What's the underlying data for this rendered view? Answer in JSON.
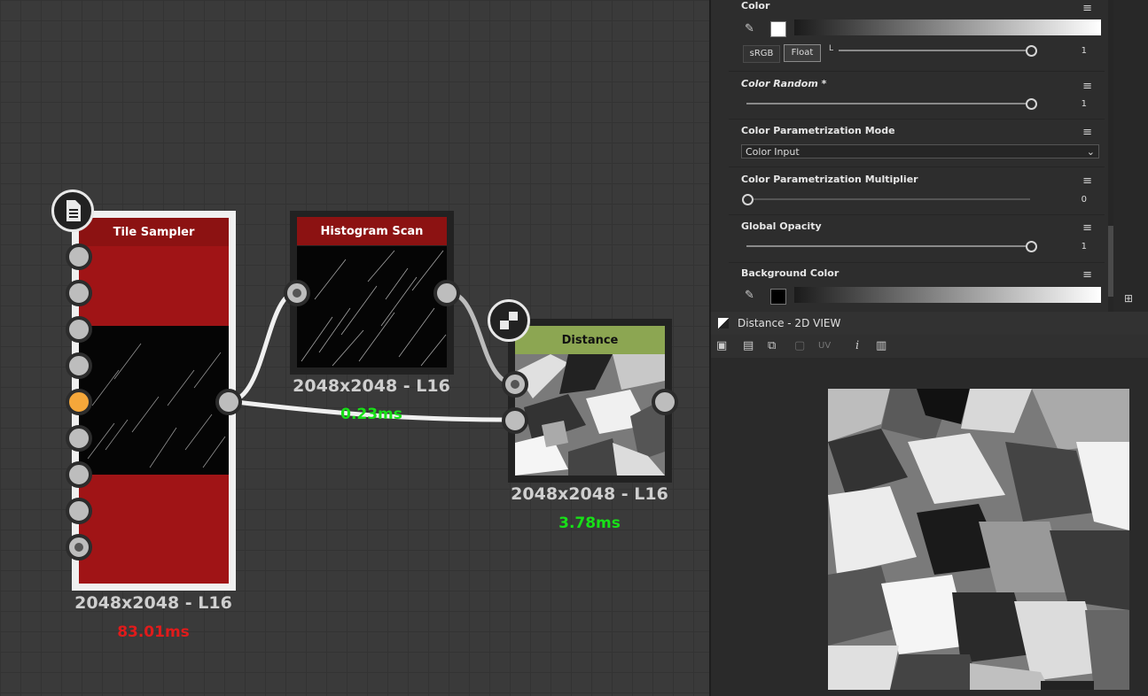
{
  "graph": {
    "nodes": [
      {
        "name": "Tile Sampler",
        "resolution": "2048x2048 - L16",
        "time": "83.01ms"
      },
      {
        "name": "Histogram Scan",
        "resolution": "2048x2048 - L16",
        "time": "0.23ms"
      },
      {
        "name": "Distance",
        "resolution": "2048x2048 - L16",
        "time": "3.78ms"
      }
    ]
  },
  "properties": {
    "color": {
      "label": "Color",
      "srgb": "sRGB",
      "float": "Float",
      "channel": "L",
      "value": "1",
      "slider_fraction": 1.0
    },
    "color_random": {
      "label": "Color Random *",
      "value": "1",
      "slider_fraction": 1.0
    },
    "parametrization_mode": {
      "label": "Color Parametrization Mode",
      "selected": "Color Input"
    },
    "parametrization_multiplier": {
      "label": "Color Parametrization Multiplier",
      "value": "0",
      "slider_fraction": 0.0
    },
    "global_opacity": {
      "label": "Global Opacity",
      "value": "1",
      "slider_fraction": 1.0
    },
    "background_color": {
      "label": "Background Color"
    }
  },
  "view2d": {
    "title": "Distance - 2D VIEW",
    "uv_label": "UV"
  },
  "colors": {
    "header_red": "#8c1212",
    "header_green": "#8ca652",
    "time_red": "#e01b1b",
    "time_green": "#18e018",
    "port_orange": "#f5a73a"
  }
}
